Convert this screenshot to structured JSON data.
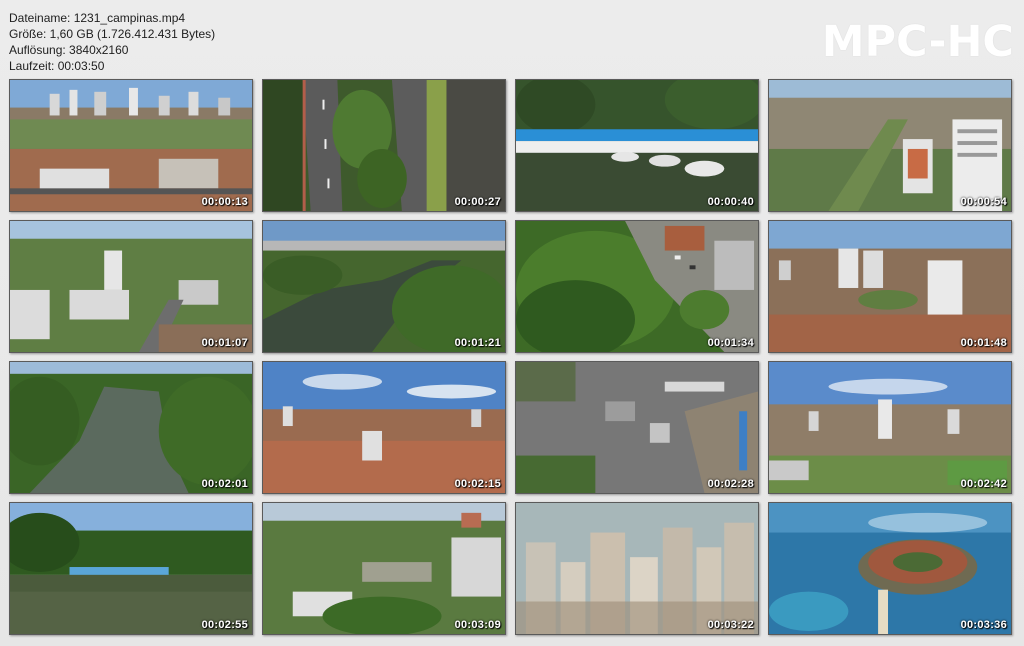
{
  "file_info": {
    "filename_line": "Dateiname: 1231_campinas.mp4",
    "size_line": "Größe: 1,60 GB (1.726.412.431 Bytes)",
    "resolution_line": "Auflösung: 3840x2160",
    "duration_line": "Laufzeit: 00:03:50"
  },
  "logo": "MPC-HC",
  "thumbnails": [
    {
      "timestamp": "00:00:13"
    },
    {
      "timestamp": "00:00:27"
    },
    {
      "timestamp": "00:00:40"
    },
    {
      "timestamp": "00:00:54"
    },
    {
      "timestamp": "00:01:07"
    },
    {
      "timestamp": "00:01:21"
    },
    {
      "timestamp": "00:01:34"
    },
    {
      "timestamp": "00:01:48"
    },
    {
      "timestamp": "00:02:01"
    },
    {
      "timestamp": "00:02:15"
    },
    {
      "timestamp": "00:02:28"
    },
    {
      "timestamp": "00:02:42"
    },
    {
      "timestamp": "00:02:55"
    },
    {
      "timestamp": "00:03:09"
    },
    {
      "timestamp": "00:03:22"
    },
    {
      "timestamp": "00:03:36"
    }
  ]
}
